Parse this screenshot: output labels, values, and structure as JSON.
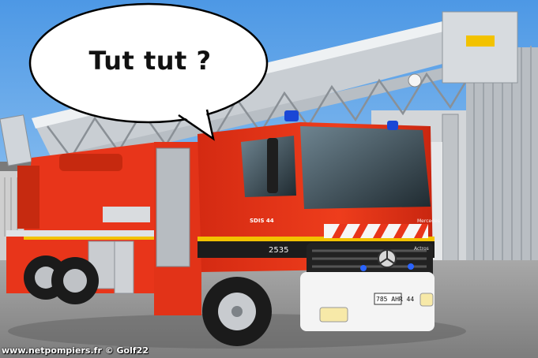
{
  "speech_bubble": {
    "text": "Tut tut ?"
  },
  "credit": "www.netpompiers.fr © Golf22",
  "truck": {
    "fleet_number": "2535",
    "door_marking": "SDIS 44",
    "license_plate": "785 AHR 44",
    "model_badge": "Actros",
    "cab_badge": "Mercedes",
    "body_color": "#e8351a",
    "accent_color": "#f2c200"
  },
  "colors": {
    "sky": "#5fa7ea",
    "ground": "#9a9a9a",
    "building": "#c9cdd1",
    "bubble": "#ffffff"
  }
}
